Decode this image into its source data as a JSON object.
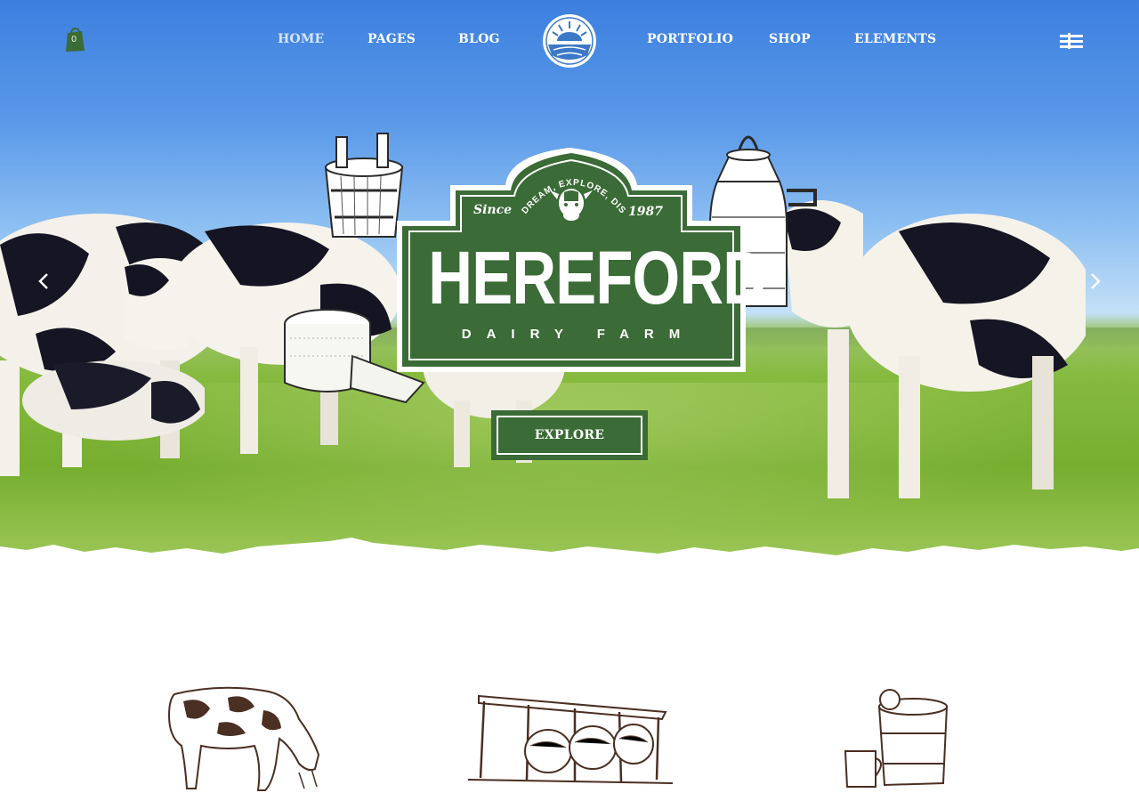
{
  "nav": {
    "cart_count": "0",
    "items": [
      {
        "label": "HOME",
        "active": true
      },
      {
        "label": "PAGES"
      },
      {
        "label": "BLOG"
      },
      {
        "label": "PORTFOLIO"
      },
      {
        "label": "SHOP"
      },
      {
        "label": "ELEMENTS"
      }
    ],
    "icons": [
      "shopping-bag-icon",
      "sun-field-logo-icon",
      "menu-icon"
    ]
  },
  "hero": {
    "badge": {
      "since": "Since",
      "year": "1987",
      "motto": "DREAM, EXPLORE, DISCOVER",
      "title": "HEREFORD",
      "subtitle": "DAIRY FARM"
    },
    "cta_label": "EXPLORE",
    "arrows": [
      "chevron-left-icon",
      "chevron-right-icon"
    ]
  },
  "colors": {
    "brand_green": "#3b6b36",
    "sky": "#4a8be3",
    "grass": "#7db334",
    "sketch_brown": "#5a3b2a"
  }
}
